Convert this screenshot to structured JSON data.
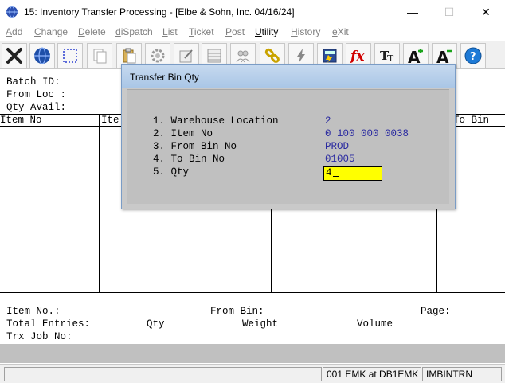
{
  "window": {
    "title": "15: Inventory Transfer Processing - [Elbe & Sohn, Inc. 04/16/24]",
    "minimize": "—",
    "maximize": "☐",
    "close": "✕"
  },
  "menu": [
    {
      "label": "Add",
      "hot": "A",
      "rest": "dd",
      "active": false
    },
    {
      "label": "Change",
      "hot": "C",
      "rest": "hange",
      "active": false
    },
    {
      "label": "Delete",
      "hot": "D",
      "rest": "elete",
      "active": false
    },
    {
      "label": "diSpatch",
      "hot": "d",
      "rest": "iSpatch",
      "active": false
    },
    {
      "label": "List",
      "hot": "L",
      "rest": "ist",
      "active": false
    },
    {
      "label": "Ticket",
      "hot": "T",
      "rest": "icket",
      "active": false
    },
    {
      "label": "Post",
      "hot": "P",
      "rest": "ost",
      "active": false
    },
    {
      "label": "Utility",
      "hot": "U",
      "rest": "tility",
      "active": true
    },
    {
      "label": "History",
      "hot": "H",
      "rest": "istory",
      "active": false
    },
    {
      "label": "eXit",
      "hot": "e",
      "rest": "Xit",
      "active": false
    }
  ],
  "toolbar_icons": [
    "close-x-icon",
    "globe-icon",
    "select-rect-icon",
    "copy-icon",
    "paste-icon",
    "settings-icon",
    "edit-icon",
    "grid-icon",
    "users-icon",
    "link-icon",
    "lightning-icon",
    "calculator-icon",
    "function-icon",
    "font-size-icon",
    "increase-font-icon",
    "decrease-font-icon",
    "help-icon"
  ],
  "header": {
    "batch_id": "Batch ID:",
    "from_loc": "From Loc :",
    "qty_avail": "Qty Avail:"
  },
  "grid": {
    "columns": [
      "Item No",
      "Ite",
      "To Bin"
    ]
  },
  "footer": {
    "item_no": "Item No.:",
    "from_bin": "From Bin:",
    "page": "Page:",
    "total_entries": "Total Entries:",
    "qty": "Qty",
    "weight": "Weight",
    "volume": "Volume",
    "trx_job_no": "Trx Job No:"
  },
  "dialog": {
    "title": "Transfer Bin Qty",
    "fields": [
      {
        "label": "1. Warehouse Location",
        "value": "2"
      },
      {
        "label": "2. Item No",
        "value": "0 100 000 0038"
      },
      {
        "label": "3. From Bin No",
        "value": "PROD"
      },
      {
        "label": "4. To Bin No",
        "value": "01005"
      },
      {
        "label": "5. Qty",
        "value": "4"
      }
    ]
  },
  "status": {
    "user": "001 EMK at DB1EMK",
    "program": "IMBINTRN"
  },
  "colors": {
    "field_value": "#2a2aa0",
    "input_bg": "#ffff00",
    "dialog_bg": "#c0c0c0"
  }
}
